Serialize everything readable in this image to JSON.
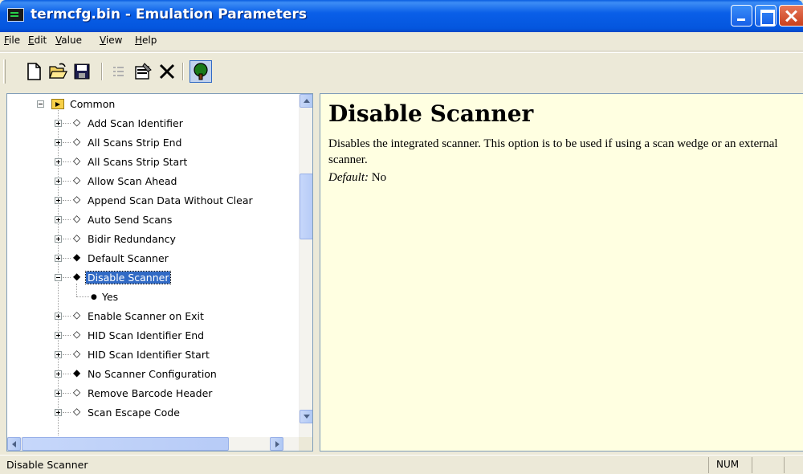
{
  "window": {
    "title": "termcfg.bin - Emulation Parameters"
  },
  "menu": {
    "items": [
      {
        "label": "File",
        "accel": "F",
        "rest": "ile"
      },
      {
        "label": "Edit",
        "accel": "E",
        "rest": "dit"
      },
      {
        "label": "Value",
        "accel": "V",
        "rest": "alue"
      },
      {
        "label": "View",
        "accel": "V",
        "rest": "iew"
      },
      {
        "label": "Help",
        "accel": "H",
        "rest": "elp"
      }
    ]
  },
  "toolbar": {
    "buttons": [
      "new-file-icon",
      "open-folder-icon",
      "save-icon",
      "list-icon",
      "properties-icon",
      "delete-icon",
      "tree-view-icon"
    ]
  },
  "tree": {
    "root": "Common",
    "items": [
      {
        "label": "Add Scan Identifier",
        "icon": "◇"
      },
      {
        "label": "All Scans Strip End",
        "icon": "◇"
      },
      {
        "label": "All Scans Strip Start",
        "icon": "◇"
      },
      {
        "label": "Allow Scan Ahead",
        "icon": "◇"
      },
      {
        "label": "Append Scan Data Without Clear",
        "icon": "◇"
      },
      {
        "label": "Auto Send Scans",
        "icon": "◇"
      },
      {
        "label": "Bidir Redundancy",
        "icon": "◇"
      },
      {
        "label": "Default Scanner",
        "icon": "◆"
      },
      {
        "label": "Disable Scanner",
        "icon": "◆"
      },
      {
        "label": "Enable Scanner on Exit",
        "icon": "◇"
      },
      {
        "label": "HID Scan Identifier End",
        "icon": "◇"
      },
      {
        "label": "HID Scan Identifier Start",
        "icon": "◇"
      },
      {
        "label": "No Scanner Configuration",
        "icon": "◆"
      },
      {
        "label": "Remove Barcode Header",
        "icon": "◇"
      },
      {
        "label": "Scan Escape Code",
        "icon": "◇"
      }
    ],
    "selected_child_value": "Yes"
  },
  "help": {
    "title": "Disable Scanner",
    "description": "Disables the integrated scanner. This option is to be used if using a scan wedge or an external scanner.",
    "default_label": "Default:",
    "default_value": " No"
  },
  "status": {
    "text": "Disable Scanner",
    "num": "NUM"
  },
  "colors": {
    "title_bar": "#0456de",
    "help_background": "#ffffe1",
    "selection": "#316ac5"
  }
}
